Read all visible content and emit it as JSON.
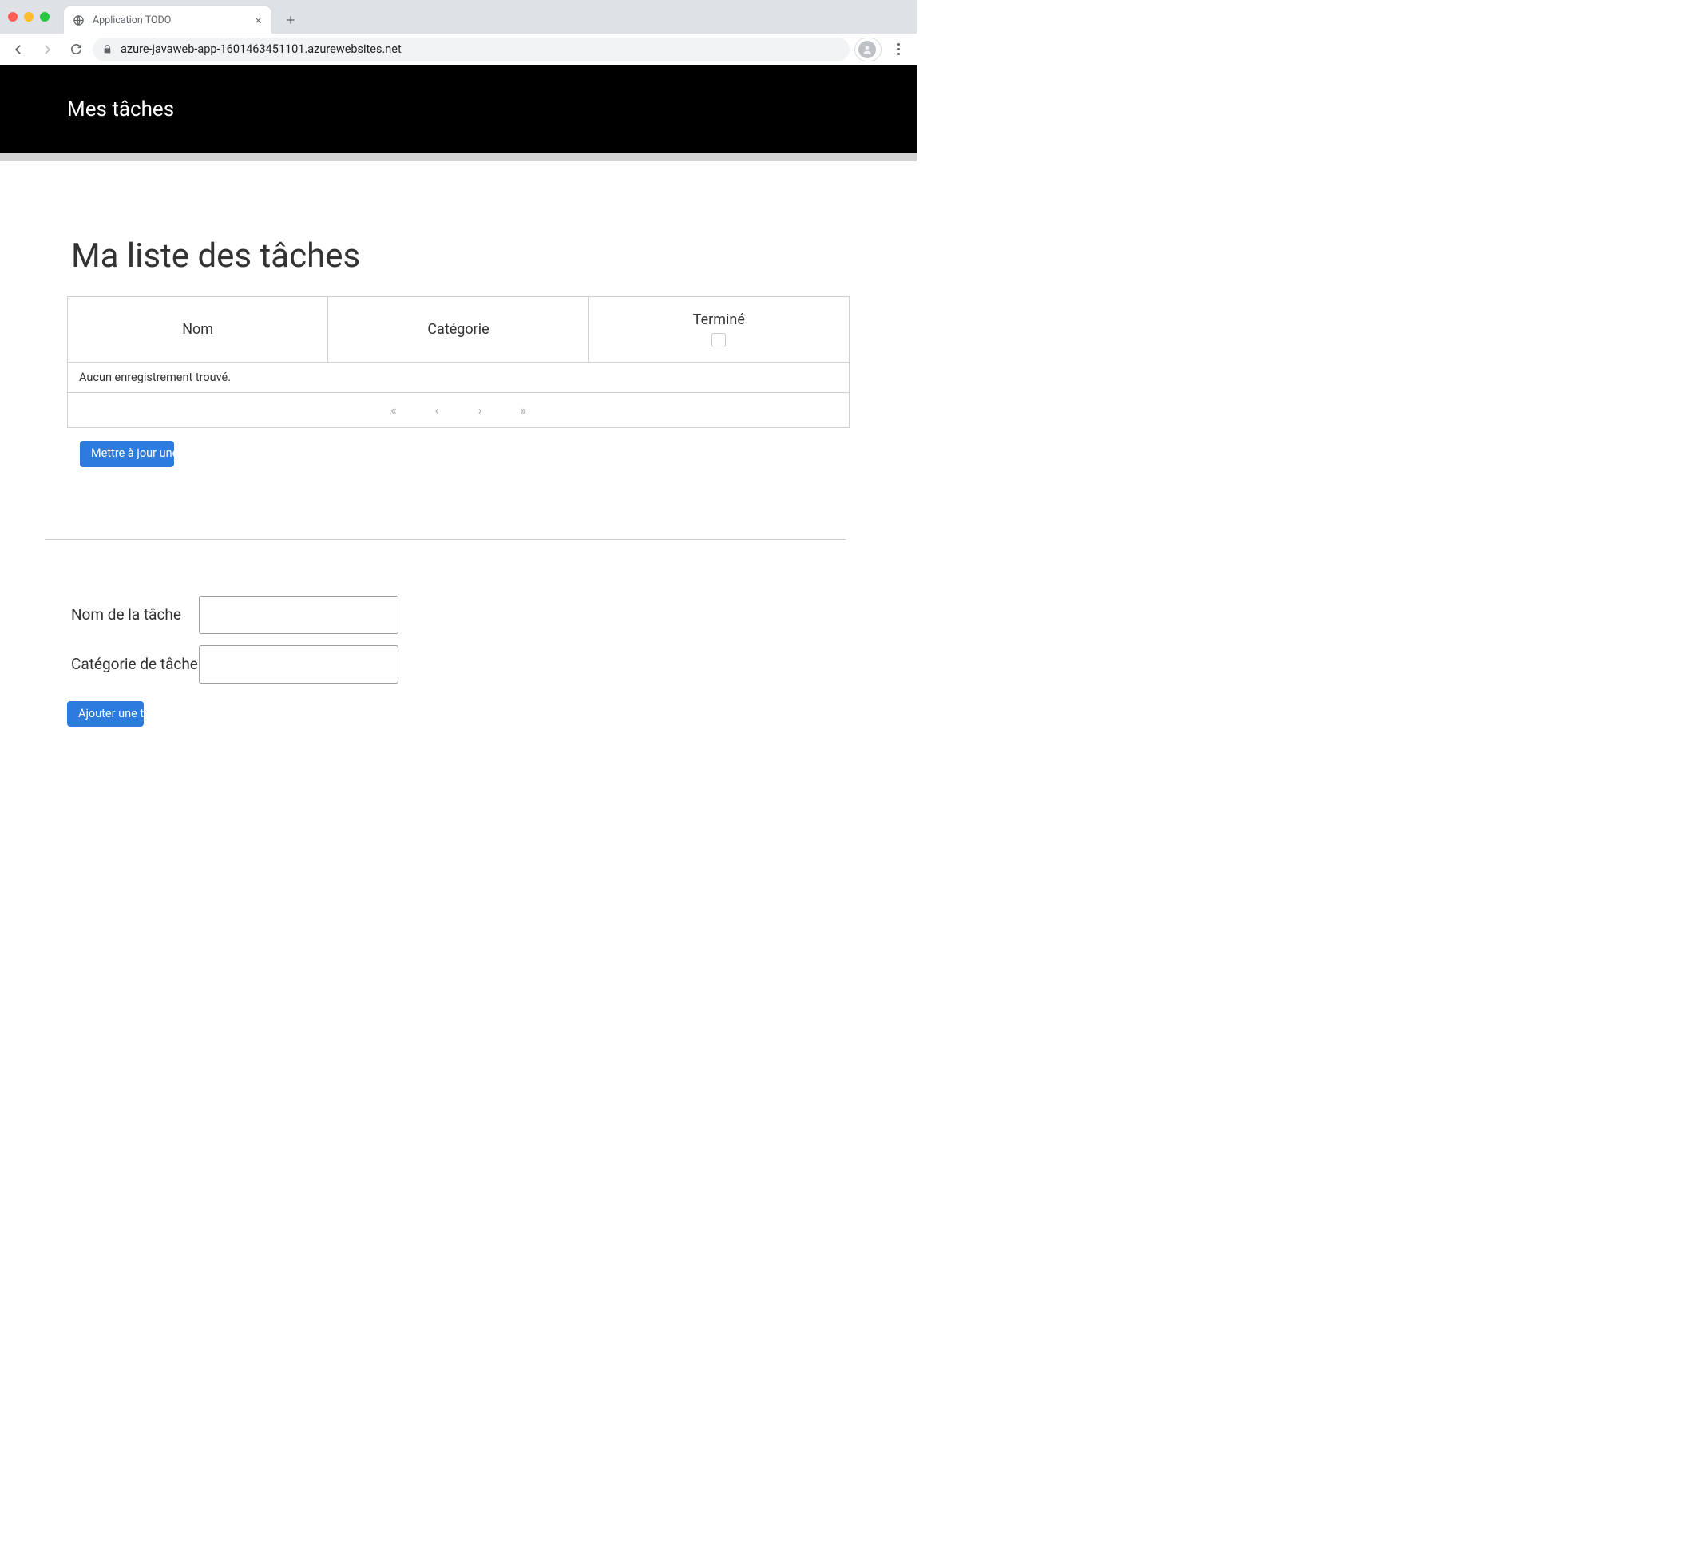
{
  "browser": {
    "tab_title": "Application TODO",
    "url": "azure-javaweb-app-1601463451101.azurewebsites.net"
  },
  "topbar": {
    "brand": "Mes tâches"
  },
  "page": {
    "title": "Ma liste des tâches",
    "table": {
      "columns": {
        "name": "Nom",
        "category": "Catégorie",
        "done": "Terminé"
      },
      "empty_message": "Aucun enregistrement trouvé."
    },
    "update_button": "Mettre à jour une tâche",
    "form": {
      "name_label": "Nom de la tâche",
      "category_label": "Catégorie de tâche",
      "name_value": "",
      "category_value": "",
      "add_button": "Ajouter une tâche"
    }
  }
}
